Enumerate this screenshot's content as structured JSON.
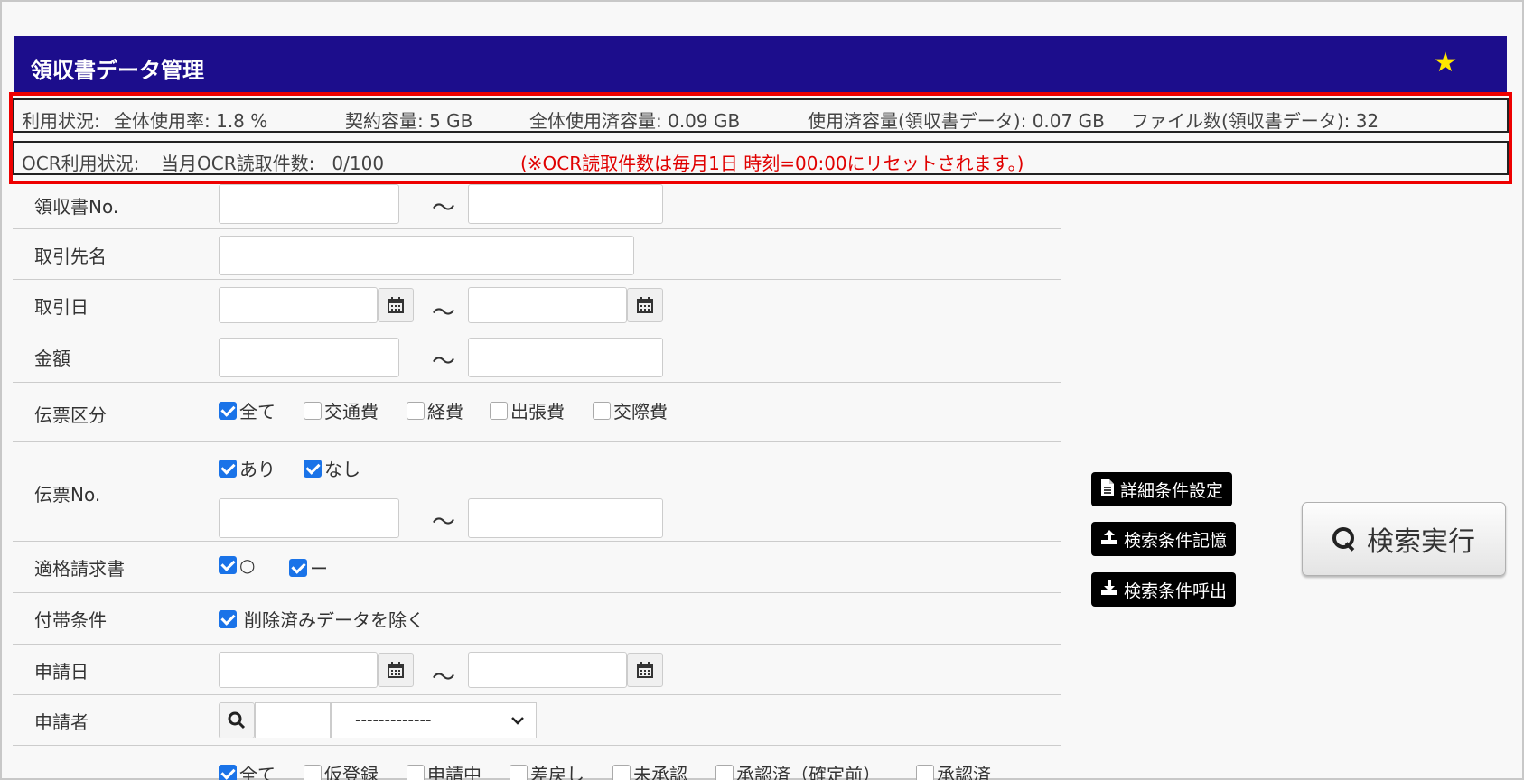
{
  "header": {
    "title": "領収書データ管理",
    "star_icon": "star-icon"
  },
  "usage": {
    "label": "利用状況:",
    "overall_rate": "全体使用率: 1.8 %",
    "contract": "契約容量: 5 GB",
    "overall_used": "全体使用済容量: 0.09 GB",
    "receipt_used": "使用済容量(領収書データ): 0.07 GB",
    "file_count": "ファイル数(領収書データ): 32"
  },
  "ocr": {
    "label": "OCR利用状況:",
    "count": "当月OCR読取件数:   0/100",
    "note": "(※OCR読取件数は毎月1日 時刻=00:00にリセットされます。)"
  },
  "form": {
    "receipt_no": "領収書No.",
    "partner": "取引先名",
    "trade_date": "取引日",
    "amount": "金額",
    "slip_type": "伝票区分",
    "slip_type_options": [
      "全て",
      "交通費",
      "経費",
      "出張費",
      "交際費"
    ],
    "slip_no": "伝票No.",
    "slip_no_options": [
      "あり",
      "なし"
    ],
    "invoice": "適格請求書",
    "invoice_options": [
      "○",
      "ー"
    ],
    "extra": "付帯条件",
    "extra_option": "削除済みデータを除く",
    "apply_date": "申請日",
    "applicant": "申請者",
    "applicant_select": "-------------",
    "status_options": [
      "全て",
      "仮登録",
      "申請中",
      "差戻し",
      "未承認",
      "承認済（確定前）",
      "承認済"
    ],
    "tilde": "～"
  },
  "buttons": {
    "detail": "詳細条件設定",
    "save": "検索条件記憶",
    "load": "検索条件呼出",
    "search": "検索実行"
  },
  "colors": {
    "header_bg": "#1c0d8c",
    "highlight": "#ee0000",
    "checkbox": "#1a73e8"
  }
}
